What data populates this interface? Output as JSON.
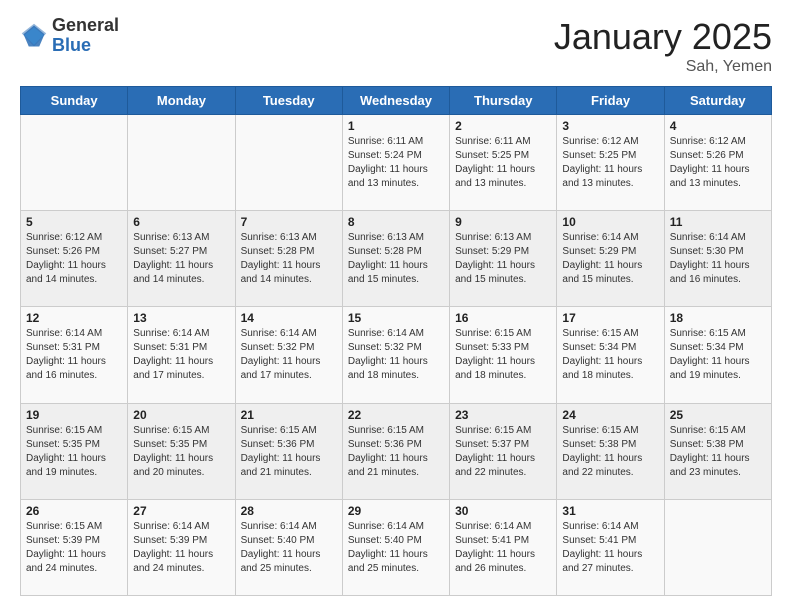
{
  "logo": {
    "general": "General",
    "blue": "Blue"
  },
  "header": {
    "month": "January 2025",
    "location": "Sah, Yemen"
  },
  "days_of_week": [
    "Sunday",
    "Monday",
    "Tuesday",
    "Wednesday",
    "Thursday",
    "Friday",
    "Saturday"
  ],
  "weeks": [
    [
      {
        "day": "",
        "sunrise": "",
        "sunset": "",
        "daylight": ""
      },
      {
        "day": "",
        "sunrise": "",
        "sunset": "",
        "daylight": ""
      },
      {
        "day": "",
        "sunrise": "",
        "sunset": "",
        "daylight": ""
      },
      {
        "day": "1",
        "sunrise": "Sunrise: 6:11 AM",
        "sunset": "Sunset: 5:24 PM",
        "daylight": "Daylight: 11 hours and 13 minutes."
      },
      {
        "day": "2",
        "sunrise": "Sunrise: 6:11 AM",
        "sunset": "Sunset: 5:25 PM",
        "daylight": "Daylight: 11 hours and 13 minutes."
      },
      {
        "day": "3",
        "sunrise": "Sunrise: 6:12 AM",
        "sunset": "Sunset: 5:25 PM",
        "daylight": "Daylight: 11 hours and 13 minutes."
      },
      {
        "day": "4",
        "sunrise": "Sunrise: 6:12 AM",
        "sunset": "Sunset: 5:26 PM",
        "daylight": "Daylight: 11 hours and 13 minutes."
      }
    ],
    [
      {
        "day": "5",
        "sunrise": "Sunrise: 6:12 AM",
        "sunset": "Sunset: 5:26 PM",
        "daylight": "Daylight: 11 hours and 14 minutes."
      },
      {
        "day": "6",
        "sunrise": "Sunrise: 6:13 AM",
        "sunset": "Sunset: 5:27 PM",
        "daylight": "Daylight: 11 hours and 14 minutes."
      },
      {
        "day": "7",
        "sunrise": "Sunrise: 6:13 AM",
        "sunset": "Sunset: 5:28 PM",
        "daylight": "Daylight: 11 hours and 14 minutes."
      },
      {
        "day": "8",
        "sunrise": "Sunrise: 6:13 AM",
        "sunset": "Sunset: 5:28 PM",
        "daylight": "Daylight: 11 hours and 15 minutes."
      },
      {
        "day": "9",
        "sunrise": "Sunrise: 6:13 AM",
        "sunset": "Sunset: 5:29 PM",
        "daylight": "Daylight: 11 hours and 15 minutes."
      },
      {
        "day": "10",
        "sunrise": "Sunrise: 6:14 AM",
        "sunset": "Sunset: 5:29 PM",
        "daylight": "Daylight: 11 hours and 15 minutes."
      },
      {
        "day": "11",
        "sunrise": "Sunrise: 6:14 AM",
        "sunset": "Sunset: 5:30 PM",
        "daylight": "Daylight: 11 hours and 16 minutes."
      }
    ],
    [
      {
        "day": "12",
        "sunrise": "Sunrise: 6:14 AM",
        "sunset": "Sunset: 5:31 PM",
        "daylight": "Daylight: 11 hours and 16 minutes."
      },
      {
        "day": "13",
        "sunrise": "Sunrise: 6:14 AM",
        "sunset": "Sunset: 5:31 PM",
        "daylight": "Daylight: 11 hours and 17 minutes."
      },
      {
        "day": "14",
        "sunrise": "Sunrise: 6:14 AM",
        "sunset": "Sunset: 5:32 PM",
        "daylight": "Daylight: 11 hours and 17 minutes."
      },
      {
        "day": "15",
        "sunrise": "Sunrise: 6:14 AM",
        "sunset": "Sunset: 5:32 PM",
        "daylight": "Daylight: 11 hours and 18 minutes."
      },
      {
        "day": "16",
        "sunrise": "Sunrise: 6:15 AM",
        "sunset": "Sunset: 5:33 PM",
        "daylight": "Daylight: 11 hours and 18 minutes."
      },
      {
        "day": "17",
        "sunrise": "Sunrise: 6:15 AM",
        "sunset": "Sunset: 5:34 PM",
        "daylight": "Daylight: 11 hours and 18 minutes."
      },
      {
        "day": "18",
        "sunrise": "Sunrise: 6:15 AM",
        "sunset": "Sunset: 5:34 PM",
        "daylight": "Daylight: 11 hours and 19 minutes."
      }
    ],
    [
      {
        "day": "19",
        "sunrise": "Sunrise: 6:15 AM",
        "sunset": "Sunset: 5:35 PM",
        "daylight": "Daylight: 11 hours and 19 minutes."
      },
      {
        "day": "20",
        "sunrise": "Sunrise: 6:15 AM",
        "sunset": "Sunset: 5:35 PM",
        "daylight": "Daylight: 11 hours and 20 minutes."
      },
      {
        "day": "21",
        "sunrise": "Sunrise: 6:15 AM",
        "sunset": "Sunset: 5:36 PM",
        "daylight": "Daylight: 11 hours and 21 minutes."
      },
      {
        "day": "22",
        "sunrise": "Sunrise: 6:15 AM",
        "sunset": "Sunset: 5:36 PM",
        "daylight": "Daylight: 11 hours and 21 minutes."
      },
      {
        "day": "23",
        "sunrise": "Sunrise: 6:15 AM",
        "sunset": "Sunset: 5:37 PM",
        "daylight": "Daylight: 11 hours and 22 minutes."
      },
      {
        "day": "24",
        "sunrise": "Sunrise: 6:15 AM",
        "sunset": "Sunset: 5:38 PM",
        "daylight": "Daylight: 11 hours and 22 minutes."
      },
      {
        "day": "25",
        "sunrise": "Sunrise: 6:15 AM",
        "sunset": "Sunset: 5:38 PM",
        "daylight": "Daylight: 11 hours and 23 minutes."
      }
    ],
    [
      {
        "day": "26",
        "sunrise": "Sunrise: 6:15 AM",
        "sunset": "Sunset: 5:39 PM",
        "daylight": "Daylight: 11 hours and 24 minutes."
      },
      {
        "day": "27",
        "sunrise": "Sunrise: 6:14 AM",
        "sunset": "Sunset: 5:39 PM",
        "daylight": "Daylight: 11 hours and 24 minutes."
      },
      {
        "day": "28",
        "sunrise": "Sunrise: 6:14 AM",
        "sunset": "Sunset: 5:40 PM",
        "daylight": "Daylight: 11 hours and 25 minutes."
      },
      {
        "day": "29",
        "sunrise": "Sunrise: 6:14 AM",
        "sunset": "Sunset: 5:40 PM",
        "daylight": "Daylight: 11 hours and 25 minutes."
      },
      {
        "day": "30",
        "sunrise": "Sunrise: 6:14 AM",
        "sunset": "Sunset: 5:41 PM",
        "daylight": "Daylight: 11 hours and 26 minutes."
      },
      {
        "day": "31",
        "sunrise": "Sunrise: 6:14 AM",
        "sunset": "Sunset: 5:41 PM",
        "daylight": "Daylight: 11 hours and 27 minutes."
      },
      {
        "day": "",
        "sunrise": "",
        "sunset": "",
        "daylight": ""
      }
    ]
  ]
}
